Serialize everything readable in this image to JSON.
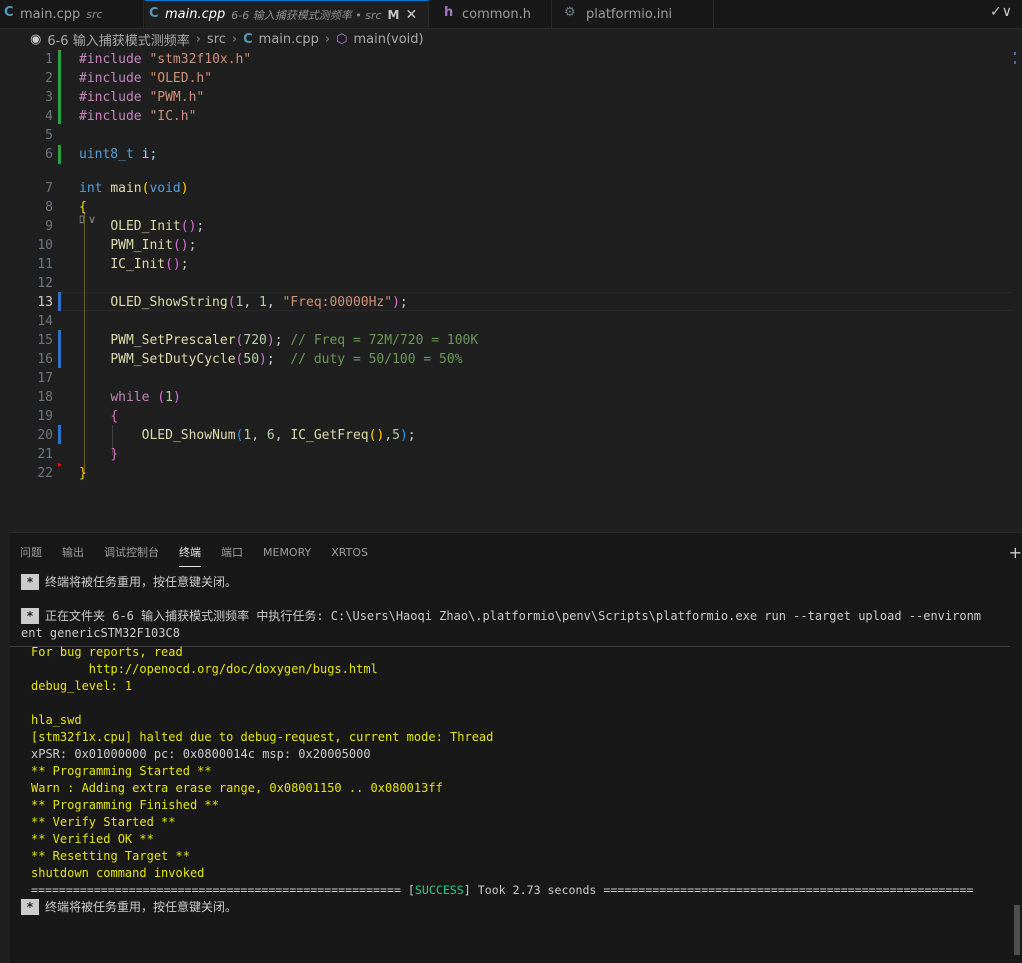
{
  "tabs": [
    {
      "label": "main.cpp",
      "desc": "src",
      "icon": "cpp-icon"
    },
    {
      "label": "main.cpp",
      "desc": "6-6 输入捕获模式测频率 • src",
      "modified": "M",
      "icon": "cpp-icon"
    },
    {
      "label": "common.h",
      "icon": "h-icon"
    },
    {
      "label": "platformio.ini",
      "icon": "gear-icon"
    }
  ],
  "breadcrumb": {
    "folder": "6-6 输入捕获模式测频率",
    "src": "src",
    "file": "main.cpp",
    "symbol": "main(void)"
  },
  "editor": {
    "line_numbers": [
      "1",
      "2",
      "3",
      "4",
      "5",
      "6",
      "7",
      "8",
      "9",
      "10",
      "11",
      "12",
      "13",
      "14",
      "15",
      "16",
      "17",
      "18",
      "19",
      "20",
      "21",
      "22"
    ],
    "current_line": "13",
    "codelens": "ﾛ ∨"
  },
  "code": {
    "l1_kw": "#include",
    "l1_str": "\"stm32f10x.h\"",
    "l2_kw": "#include",
    "l2_str": "\"OLED.h\"",
    "l3_kw": "#include",
    "l3_str": "\"PWM.h\"",
    "l4_kw": "#include",
    "l4_str": "\"IC.h\"",
    "l6_type": "uint8_t",
    "l6_var": "i;",
    "l7_type": "int",
    "l7_fn": "main",
    "l7_open": "(",
    "l7_void": "void",
    "l7_close": ")",
    "l8": "{",
    "l9_fn": "OLED_Init",
    "l9_par": "()",
    "l9_end": ";",
    "l10_fn": "PWM_Init",
    "l10_par": "()",
    "l10_end": ";",
    "l11_fn": "IC_Init",
    "l11_par": "()",
    "l11_end": ";",
    "l13_fn": "OLED_ShowString",
    "l13_open": "(",
    "l13_n1": "1",
    "l13_c1": ", ",
    "l13_n2": "1",
    "l13_c2": ", ",
    "l13_str": "\"Freq:00000Hz\"",
    "l13_close": ")",
    "l13_end": ";",
    "l15_fn": "PWM_SetPrescaler",
    "l15_open": "(",
    "l15_num": "720",
    "l15_close": ")",
    "l15_end": "; ",
    "l15_cmt": "// Freq = 72M/720 = 100K",
    "l16_fn": "PWM_SetDutyCycle",
    "l16_open": "(",
    "l16_num": "50",
    "l16_close": ")",
    "l16_end": ";  ",
    "l16_cmt": "// duty = 50/100 = 50%",
    "l18_kw": "while",
    "l18_open": " (",
    "l18_num": "1",
    "l18_close": ")",
    "l19": "{",
    "l20_fn": "OLED_ShowNum",
    "l20_open": "(",
    "l20_n1": "1",
    "l20_c1": ", ",
    "l20_n2": "6",
    "l20_c2": ", ",
    "l20_fn2": "IC_GetFreq",
    "l20_par": "()",
    "l20_c3": ",",
    "l20_n3": "5",
    "l20_close": ")",
    "l20_end": ";",
    "l21": "}",
    "l22": "}"
  },
  "panel": {
    "tabs": [
      "问题",
      "输出",
      "调试控制台",
      "终端",
      "端口",
      "MEMORY",
      "XRTOS"
    ],
    "active_tab": "终端"
  },
  "terminal": {
    "l1": "终端将被任务重用，按任意键关闭。",
    "l2": "正在文件夹 6-6 输入捕获模式测频率 中执行任务: C:\\Users\\Haoqi Zhao\\.platformio\\penv\\Scripts\\platformio.exe run --target upload --environm",
    "l3": "ent genericSTM32F103C8",
    "l4": "For bug reports, read",
    "l5": "        http://openocd.org/doc/doxygen/bugs.html",
    "l6": "debug_level: 1",
    "l7": "hla_swd",
    "l8": "[stm32f1x.cpu] halted due to debug-request, current mode: Thread",
    "l9": "xPSR: 0x01000000 pc: 0x0800014c msp: 0x20005000",
    "l10": "** Programming Started **",
    "l11": "Warn : Adding extra erase range, 0x08001150 .. 0x080013ff",
    "l12": "** Programming Finished **",
    "l13": "** Verify Started **",
    "l14": "** Verified OK **",
    "l15": "** Resetting Target **",
    "l16": "shutdown command invoked",
    "l17_left": "===================================================== [",
    "l17_success": "SUCCESS",
    "l17_right": "] Took 2.73 seconds =====================================================",
    "l18": "终端将被任务重用，按任意键关闭。",
    "badge": "*"
  }
}
